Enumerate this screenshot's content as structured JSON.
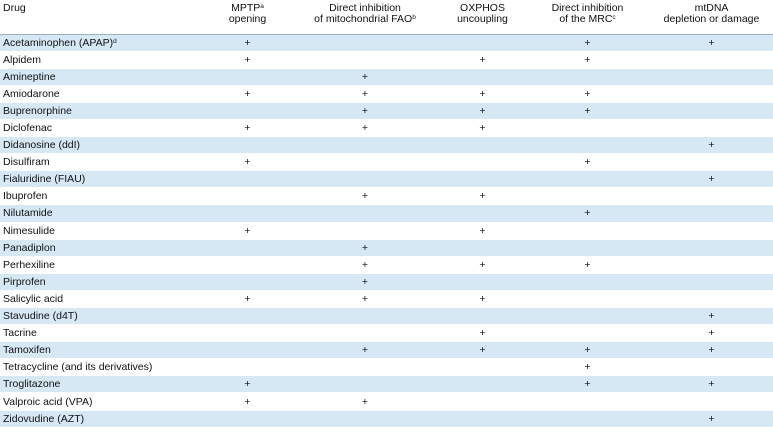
{
  "headers": [
    {
      "line1": "Drug",
      "line2": "",
      "sup": ""
    },
    {
      "line1": "MPTP",
      "sup": "a",
      "line2": "opening"
    },
    {
      "line1": "Direct inhibition",
      "line2": "of mitochondrial FAO",
      "sup": "b"
    },
    {
      "line1": "OXPHOS",
      "line2": "uncoupling",
      "sup": ""
    },
    {
      "line1": "Direct inhibition",
      "line2": "of the MRC",
      "sup": "c"
    },
    {
      "line1": "mtDNA",
      "line2": "depletion or damage",
      "sup": ""
    }
  ],
  "mark_symbol": "+",
  "colors": {
    "row_shade": "#d7e8f5",
    "header_rule": "#9ab0bf"
  },
  "rows": [
    {
      "drug": "Acetaminophen (APAP)",
      "sup": "d",
      "marks": [
        true,
        false,
        false,
        true,
        true
      ]
    },
    {
      "drug": "Alpidem",
      "sup": "",
      "marks": [
        true,
        false,
        true,
        true,
        false
      ]
    },
    {
      "drug": "Amineptine",
      "sup": "",
      "marks": [
        false,
        true,
        false,
        false,
        false
      ]
    },
    {
      "drug": "Amiodarone",
      "sup": "",
      "marks": [
        true,
        true,
        true,
        true,
        false
      ]
    },
    {
      "drug": "Buprenorphine",
      "sup": "",
      "marks": [
        false,
        true,
        true,
        true,
        false
      ]
    },
    {
      "drug": "Diclofenac",
      "sup": "",
      "marks": [
        true,
        true,
        true,
        false,
        false
      ]
    },
    {
      "drug": "Didanosine (ddI)",
      "sup": "",
      "marks": [
        false,
        false,
        false,
        false,
        true
      ]
    },
    {
      "drug": "Disulfiram",
      "sup": "",
      "marks": [
        true,
        false,
        false,
        true,
        false
      ]
    },
    {
      "drug": "Fialuridine (FIAU)",
      "sup": "",
      "marks": [
        false,
        false,
        false,
        false,
        true
      ]
    },
    {
      "drug": "Ibuprofen",
      "sup": "",
      "marks": [
        false,
        true,
        true,
        false,
        false
      ]
    },
    {
      "drug": "Nilutamide",
      "sup": "",
      "marks": [
        false,
        false,
        false,
        true,
        false
      ]
    },
    {
      "drug": "Nimesulide",
      "sup": "",
      "marks": [
        true,
        false,
        true,
        false,
        false
      ]
    },
    {
      "drug": "Panadiplon",
      "sup": "",
      "marks": [
        false,
        true,
        false,
        false,
        false
      ]
    },
    {
      "drug": "Perhexiline",
      "sup": "",
      "marks": [
        false,
        true,
        true,
        true,
        false
      ]
    },
    {
      "drug": "Pirprofen",
      "sup": "",
      "marks": [
        false,
        true,
        false,
        false,
        false
      ]
    },
    {
      "drug": "Salicylic acid",
      "sup": "",
      "marks": [
        true,
        true,
        true,
        false,
        false
      ]
    },
    {
      "drug": "Stavudine (d4T)",
      "sup": "",
      "marks": [
        false,
        false,
        false,
        false,
        true
      ]
    },
    {
      "drug": "Tacrine",
      "sup": "",
      "marks": [
        false,
        false,
        true,
        false,
        true
      ]
    },
    {
      "drug": "Tamoxifen",
      "sup": "",
      "marks": [
        false,
        true,
        true,
        true,
        true
      ]
    },
    {
      "drug": "Tetracycline (and its derivatives)",
      "sup": "",
      "marks": [
        false,
        false,
        false,
        true,
        false
      ]
    },
    {
      "drug": "Troglitazone",
      "sup": "",
      "marks": [
        true,
        false,
        false,
        true,
        true
      ]
    },
    {
      "drug": "Valproic acid (VPA)",
      "sup": "",
      "marks": [
        true,
        true,
        false,
        false,
        false
      ]
    },
    {
      "drug": "Zidovudine (AZT)",
      "sup": "",
      "marks": [
        false,
        false,
        false,
        false,
        true
      ]
    }
  ]
}
